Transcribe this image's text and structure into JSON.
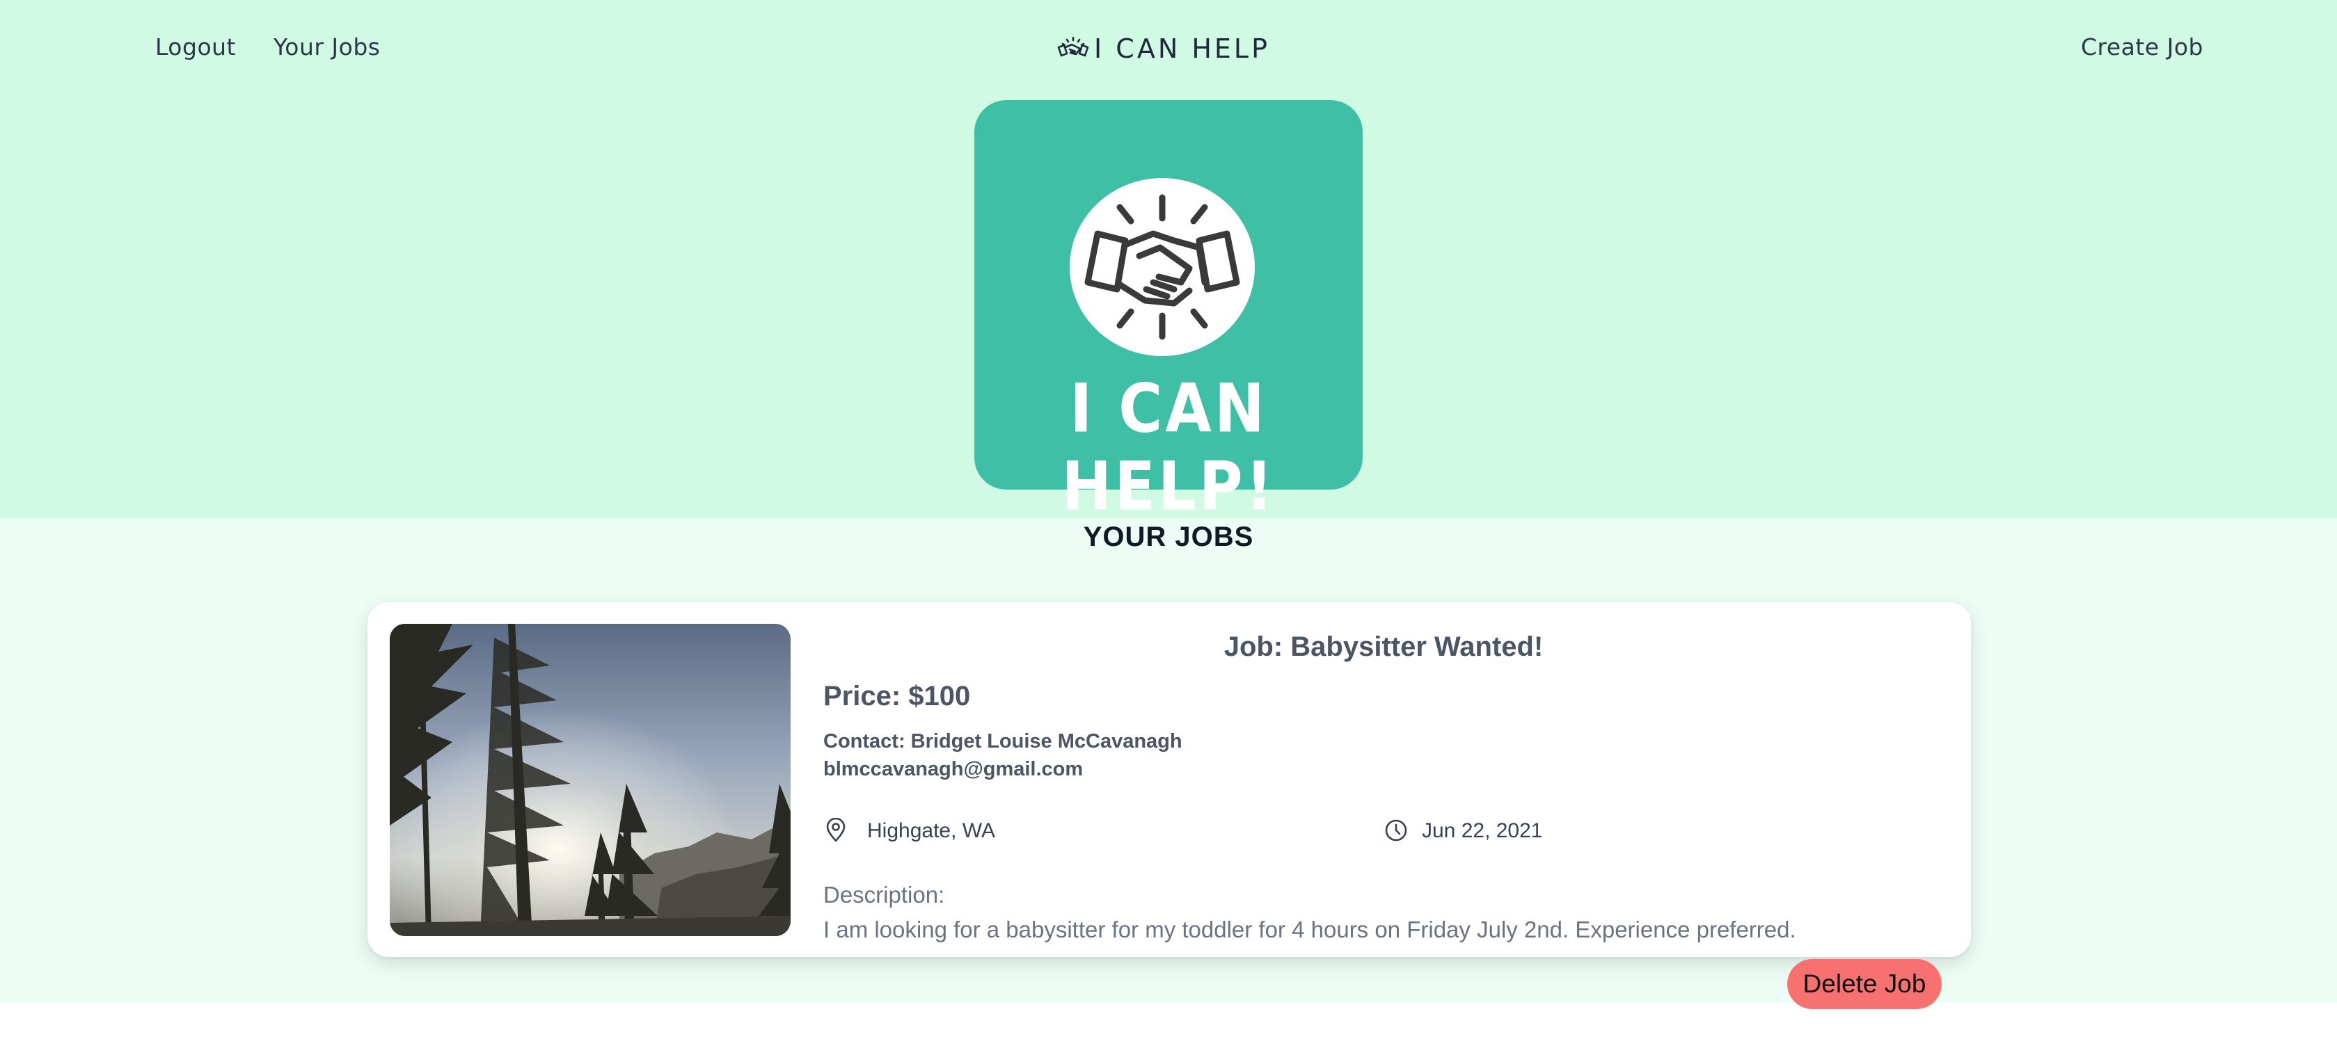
{
  "nav": {
    "logout_label": "Logout",
    "your_jobs_label": "Your Jobs",
    "brand_text": "I CAN HELP",
    "create_job_label": "Create Job"
  },
  "hero": {
    "logo_text": "I CAN HELP!",
    "icon": "handshake-icon"
  },
  "section": {
    "title": "YOUR JOBS"
  },
  "jobs": [
    {
      "title": "Job: Babysitter Wanted!",
      "price": "Price: $100",
      "contact": "Contact: Bridget Louise McCavanagh",
      "email": "blmccavanagh@gmail.com",
      "location": "Highgate, WA",
      "date": "Jun 22, 2021",
      "description_label": "Description:",
      "description": "I am looking for a babysitter for my toddler for 4 hours on Friday July 2nd. Experience preferred.",
      "delete_label": "Delete Job"
    }
  ],
  "colors": {
    "header_bg": "#d1fae5",
    "section_bg": "#ecfdf5",
    "logo_bg": "#3ebfa6",
    "delete_bg": "#f87171"
  }
}
